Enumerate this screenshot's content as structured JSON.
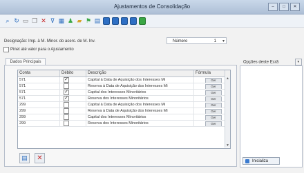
{
  "window": {
    "title": "Ajustamentos de Consolidação"
  },
  "toolbar": {
    "icons": [
      "search-icon",
      "refresh-icon",
      "new-icon",
      "copy-icon",
      "delete-icon",
      "filter-icon",
      "chart-icon",
      "users-icon",
      "folder-icon",
      "flag-icon",
      "grid-icon",
      "blue-square-icon",
      "blue-square-icon",
      "blue-square-icon",
      "blue-square-icon",
      "green-square-icon"
    ]
  },
  "form": {
    "designation_label": "Designação:",
    "designation_value": "Imp. à M. Minor. do acerc. de M. Inv.",
    "number_label": "Número",
    "number_value": "1",
    "checkbox_label": "Pinet até valor para o Ajustamento"
  },
  "tabs": [
    {
      "label": "Dados Principais"
    }
  ],
  "grid": {
    "columns": [
      "Conta",
      "Débito",
      "Descrição",
      "Fórmula"
    ],
    "formula_button_label": "Ger",
    "rows": [
      {
        "conta": "571",
        "debito": true,
        "descricao": "Capital à Data de Aquisição dos Interesses Mi"
      },
      {
        "conta": "571",
        "debito": false,
        "descricao": "Reserva à Data de Aquisição dos Interesses Mi"
      },
      {
        "conta": "571",
        "debito": true,
        "descricao": "Capital dos Interesses Minoritários"
      },
      {
        "conta": "571",
        "debito": true,
        "descricao": "Reserva dos Interesses Minoritários"
      },
      {
        "conta": "299",
        "debito": false,
        "descricao": "Capital à Data de Aquisição dos Interesses Mi"
      },
      {
        "conta": "299",
        "debito": false,
        "descricao": "Reserva à Data de Aquisição dos Interesses Mi"
      },
      {
        "conta": "299",
        "debito": false,
        "descricao": "Capital dos Interesses Minoritários"
      },
      {
        "conta": "299",
        "debito": false,
        "descricao": "Reserva dos Interesses Minoritários"
      }
    ]
  },
  "right_panel": {
    "label": "Opções deste Ecrã",
    "button_label": "Inicializa"
  }
}
